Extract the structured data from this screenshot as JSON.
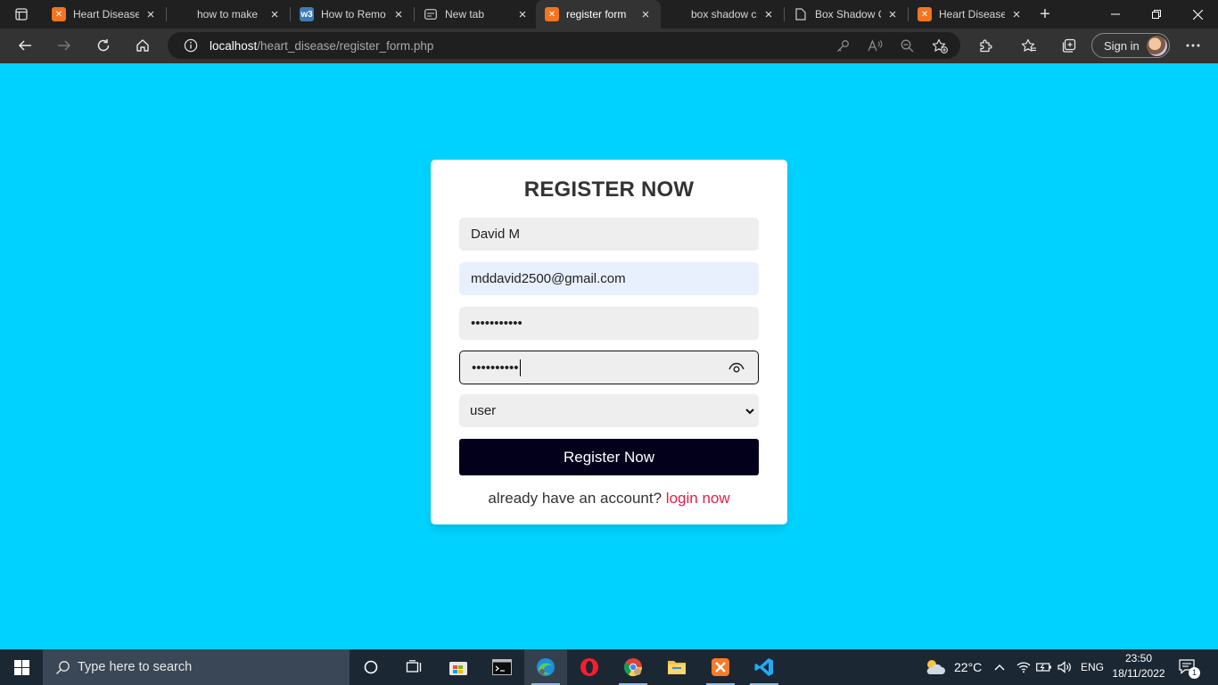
{
  "browser": {
    "tabs": [
      {
        "title": "Heart Disease",
        "favicon": "xampp-icon",
        "active": false
      },
      {
        "title": "how to make",
        "favicon": "edge-blank-icon",
        "active": false
      },
      {
        "title": "How to Remo",
        "favicon": "w3schools-icon",
        "active": false
      },
      {
        "title": "New tab",
        "favicon": "newtab-icon",
        "active": false
      },
      {
        "title": "register form",
        "favicon": "xampp-icon",
        "active": true
      },
      {
        "title": "box shadow c",
        "favicon": "edge-blank-icon",
        "active": false
      },
      {
        "title": "Box Shadow C",
        "favicon": "document-icon",
        "active": false
      },
      {
        "title": "Heart Disease",
        "favicon": "xampp-icon",
        "active": false
      }
    ],
    "url_host": "localhost",
    "url_path": "/heart_disease/register_form.php",
    "signin_label": "Sign in"
  },
  "form": {
    "heading": "REGISTER NOW",
    "name_value": "David M",
    "email_value": "mddavid2500@gmail.com",
    "password_value": "•••••••••••",
    "confirm_password_value": "••••••••••",
    "user_type_selected": "user",
    "submit_label": "Register Now",
    "footer_text": "already have an account?",
    "login_link": "login now"
  },
  "taskbar": {
    "search_placeholder": "Type here to search",
    "weather": "22°C",
    "language": "ENG",
    "time": "23:50",
    "date": "18/11/2022",
    "notification_count": "1"
  },
  "colors": {
    "page_background": "#00d2ff",
    "button": "#03001c",
    "link": "#e0204b"
  }
}
